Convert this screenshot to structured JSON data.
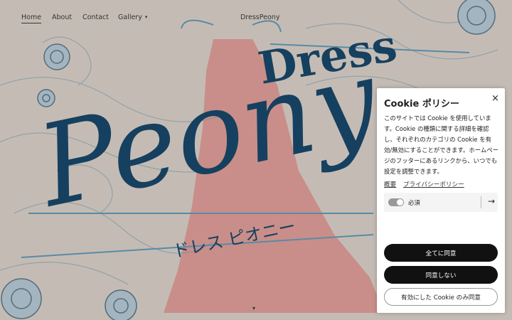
{
  "nav": {
    "items": [
      "Home",
      "About",
      "Contact",
      "Gallery"
    ],
    "gallery_caret": "▾",
    "brand": "DressPeony"
  },
  "hero": {
    "line1": "Dress",
    "line2": "Peony",
    "subtitle": "ドレス ピオニー",
    "colors": {
      "navy": "#16405f",
      "dress": "#c98b87",
      "background": "#c4bcb4",
      "lines": "#5a8aa6"
    }
  },
  "scroll_indicator": "▾",
  "cookie": {
    "title": "Cookie ポリシー",
    "close": "×",
    "body": "このサイトでは Cookie を使用しています。Cookie の種類に関する詳細を確認し、それぞれのカテゴリの Cookie を有効/無効にすることができます。ホームページのフッターにあるリンクから、いつでも設定を調整できます。",
    "links": [
      "概要",
      "プライバシーポリシー"
    ],
    "category": {
      "label": "必須",
      "enabled": true,
      "arrow": "→"
    },
    "buttons": {
      "accept_all": "全てに同意",
      "reject": "同意しない",
      "accept_selected": "有効にした Cookie のみ同意"
    }
  }
}
